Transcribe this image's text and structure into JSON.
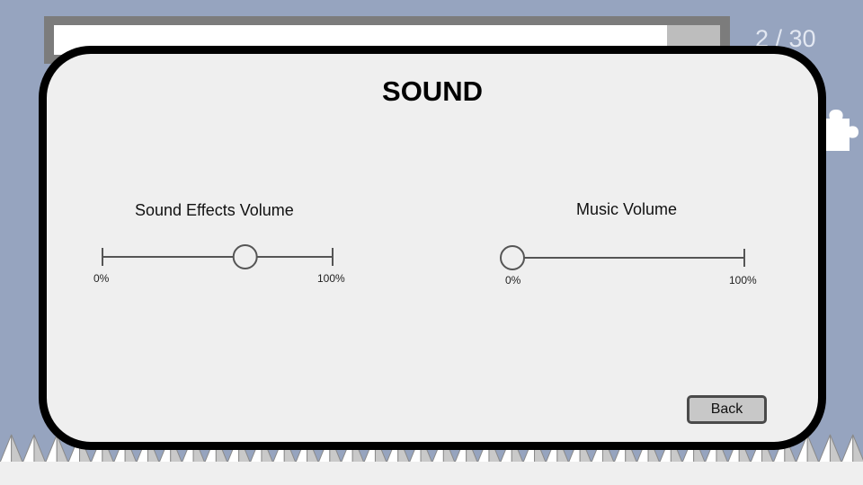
{
  "level_progress": {
    "fraction_complete": 0.92,
    "counter_text": "2 / 30"
  },
  "side_icon": "puzzle-piece-icon",
  "sound_menu": {
    "title": "SOUND",
    "sound_effects": {
      "label": "Sound Effects Volume",
      "value_percent": 62,
      "min_label": "0%",
      "max_label": "100%"
    },
    "music": {
      "label": "Music Volume",
      "value_percent": 0,
      "min_label": "0%",
      "max_label": "100%"
    },
    "back_label": "Back"
  },
  "colors": {
    "background": "#96a4bf",
    "panel": "#efefef",
    "panel_border": "#000000",
    "slider_track": "#555555",
    "button_fill": "#c8c8c8"
  }
}
